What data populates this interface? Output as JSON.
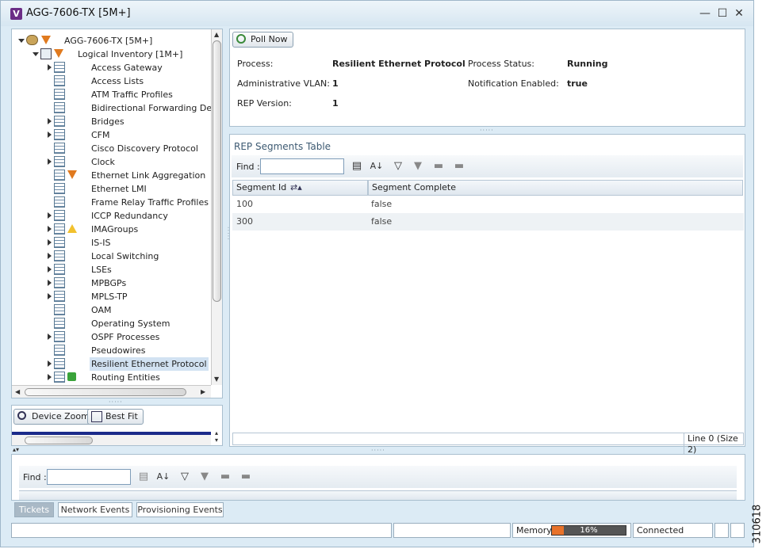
{
  "window": {
    "title": "AGG-7606-TX [5M+]",
    "logo_letter": "V",
    "minimize": "—",
    "maximize": "☐",
    "close": "✕"
  },
  "tree": {
    "root": "AGG-7606-TX [5M+]",
    "logical": "Logical Inventory [1M+]",
    "items": [
      {
        "label": "Access Gateway",
        "expandable": true,
        "badge": ""
      },
      {
        "label": "Access Lists",
        "expandable": false,
        "badge": ""
      },
      {
        "label": "ATM Traffic Profiles",
        "expandable": false,
        "badge": ""
      },
      {
        "label": "Bidirectional Forwarding Detect",
        "expandable": false,
        "badge": ""
      },
      {
        "label": "Bridges",
        "expandable": true,
        "badge": ""
      },
      {
        "label": "CFM",
        "expandable": true,
        "badge": ""
      },
      {
        "label": "Cisco Discovery Protocol",
        "expandable": false,
        "badge": ""
      },
      {
        "label": "Clock",
        "expandable": true,
        "badge": ""
      },
      {
        "label": "Ethernet Link Aggregation",
        "expandable": false,
        "badge": "minor"
      },
      {
        "label": "Ethernet LMI",
        "expandable": false,
        "badge": ""
      },
      {
        "label": "Frame Relay Traffic Profiles",
        "expandable": false,
        "badge": ""
      },
      {
        "label": "ICCP Redundancy",
        "expandable": true,
        "badge": ""
      },
      {
        "label": "IMAGroups",
        "expandable": true,
        "badge": "warning"
      },
      {
        "label": "IS-IS",
        "expandable": true,
        "badge": ""
      },
      {
        "label": "Local Switching",
        "expandable": true,
        "badge": ""
      },
      {
        "label": "LSEs",
        "expandable": true,
        "badge": ""
      },
      {
        "label": "MPBGPs",
        "expandable": true,
        "badge": ""
      },
      {
        "label": "MPLS-TP",
        "expandable": true,
        "badge": ""
      },
      {
        "label": "OAM",
        "expandable": false,
        "badge": ""
      },
      {
        "label": "Operating System",
        "expandable": false,
        "badge": ""
      },
      {
        "label": "OSPF Processes",
        "expandable": true,
        "badge": ""
      },
      {
        "label": "Pseudowires",
        "expandable": false,
        "badge": ""
      },
      {
        "label": "Resilient Ethernet Protocol",
        "expandable": true,
        "badge": "",
        "selected": true
      },
      {
        "label": "Routing Entities",
        "expandable": true,
        "badge": "ok"
      }
    ]
  },
  "zoom": {
    "device_zoom": "Device Zoom",
    "best_fit": "Best Fit"
  },
  "details": {
    "poll_now": "Poll Now",
    "process_label": "Process:",
    "process_value": "Resilient Ethernet Protocol",
    "status_label": "Process Status:",
    "status_value": "Running",
    "vlan_label": "Administrative VLAN:",
    "vlan_value": "1",
    "notif_label": "Notification Enabled:",
    "notif_value": "true",
    "version_label": "REP Version:",
    "version_value": "1"
  },
  "segments": {
    "title": "REP Segments Table",
    "find_label": "Find :",
    "find_value": "",
    "col_segment_id": "Segment Id",
    "col_complete": "Segment Complete",
    "rows": [
      {
        "id": "100",
        "complete": "false"
      },
      {
        "id": "300",
        "complete": "false"
      }
    ],
    "footer": "Line 0 (Size 2)"
  },
  "bottom": {
    "find_label": "Find :",
    "find_value": "",
    "tabs": [
      "Tickets",
      "Network Events",
      "Provisioning Events"
    ],
    "active_tab": "Tickets"
  },
  "status": {
    "memory_label": "Memory:",
    "memory_value": "16%",
    "memory_fraction": 0.16,
    "connection": "Connected"
  },
  "figure_number": "310618",
  "colors": {
    "accent": "#6b2d86",
    "selection": "#d2e2f2",
    "memory_bar": "#e8722a"
  }
}
